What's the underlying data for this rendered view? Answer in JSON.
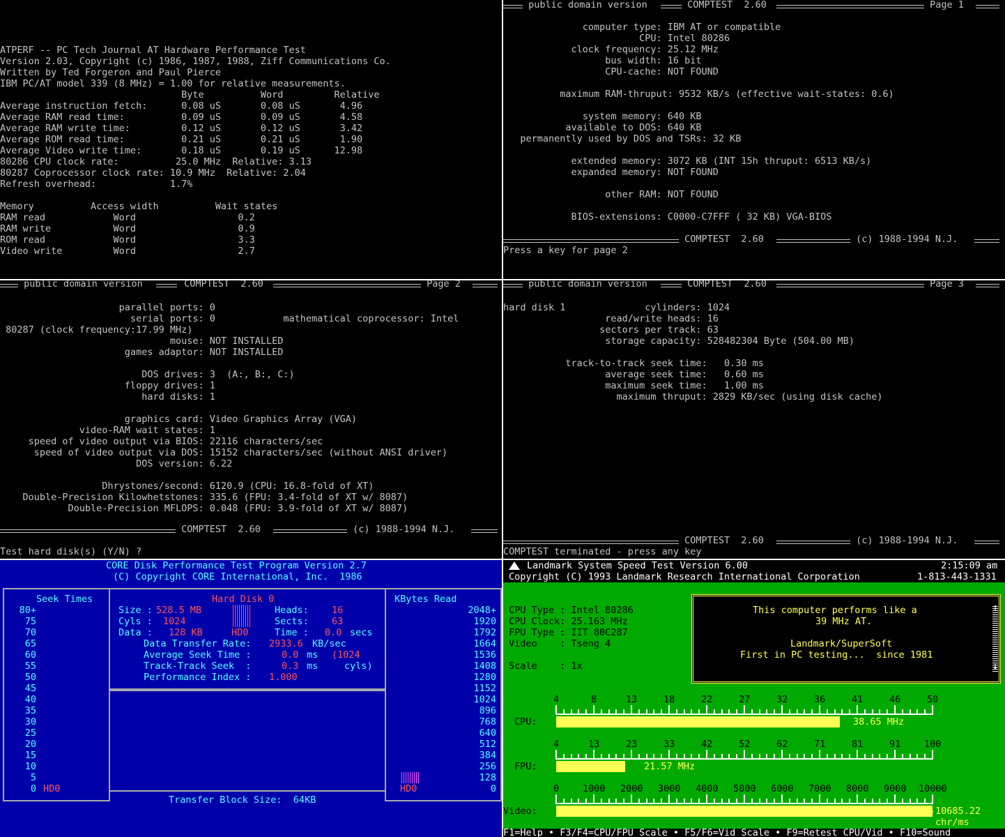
{
  "atperf": {
    "lines": [
      "",
      "",
      "",
      "",
      "ATPERF -- PC Tech Journal AT Hardware Performance Test",
      "Version 2.03, Copyright (c) 1986, 1987, 1988, Ziff Communications Co.",
      "Written by Ted Forgeron and Paul Pierce",
      "IBM PC/AT model 339 (8 MHz) = 1.00 for relative measurements.",
      "                                Byte          Word         Relative",
      "Average instruction fetch:      0.08 uS       0.08 uS       4.96",
      "Average RAM read time:          0.09 uS       0.09 uS       4.58",
      "Average RAM write time:         0.12 uS       0.12 uS       3.42",
      "Average ROM read time:          0.21 uS       0.21 uS       1.90",
      "Average Video write time:       0.18 uS       0.19 uS      12.98",
      "80286 CPU clock rate:          25.0 MHz  Relative: 3.13",
      "80287 Coprocessor clock rate: 10.9 MHz  Relative: 2.04",
      "Refresh overhead:             1.7%",
      "",
      "Memory          Access width          Wait states",
      "RAM read            Word                  0.2",
      "RAM write           Word                  0.9",
      "ROM read            Word                  3.3",
      "Video write         Word                  2.7"
    ]
  },
  "comptest_p1": {
    "header_left": " public domain version ",
    "header_mid": " COMPTEST  2.60 ",
    "header_right": " Page 1 ",
    "lines": [
      "              computer type: IBM AT or compatible",
      "                        CPU: Intel 80286",
      "            clock frequency: 25.12 MHz",
      "                  bus width: 16 bit",
      "                  CPU-cache: NOT FOUND",
      "",
      "          maximum RAM-thruput: 9532 KB/s (effective wait-states: 0.6)",
      "",
      "              system memory: 640 KB",
      "           available to DOS: 640 KB",
      "   permanently used by DOS and TSRs: 32 KB",
      "",
      "            extended memory: 3072 KB (INT 15h thruput: 6513 KB/s)",
      "            expanded memory: NOT FOUND",
      "",
      "                  other RAM: NOT FOUND",
      "",
      "            BIOS-extensions: C0000-C7FFF ( 32 KB) VGA-BIOS"
    ],
    "footer_mid": " COMPTEST  2.60 ",
    "footer_right": " (c) 1988-1994 N.J. ",
    "prompt": "Press a key for page 2"
  },
  "comptest_p2": {
    "header_left": " public domain version ",
    "header_mid": " COMPTEST  2.60 ",
    "header_right": " Page 2 ",
    "lines": [
      "                     parallel ports: 0",
      "                       serial ports: 0            mathematical coprocessor: Intel",
      " 80287 (clock frequency:17.99 MHz)",
      "                              mouse: NOT INSTALLED",
      "                      games adaptor: NOT INSTALLED",
      "",
      "                         DOS drives: 3  (A:, B:, C:)",
      "                      floppy drives: 1",
      "                         hard disks: 1",
      "",
      "                      graphics card: Video Graphics Array (VGA)",
      "              video-RAM wait states: 1",
      "     speed of video output via BIOS: 22116 characters/sec",
      "      speed of video output via DOS: 15152 characters/sec (without ANSI driver)",
      "                        DOS version: 6.22",
      "",
      "                  Dhrystones/second: 6120.9 (CPU: 16.8-fold of XT)",
      "    Double-Precision Kilowhetstones: 335.6 (FPU: 3.4-fold of XT w/ 8087)",
      "            Double-Precision MFLOPS: 0.048 (FPU: 3.9-fold of XT w/ 8087)"
    ],
    "footer_mid": " COMPTEST  2.60 ",
    "footer_right": " (c) 1988-1994 N.J. ",
    "prompt": "Test hard disk(s) (Y/N) ?"
  },
  "comptest_p3": {
    "header_left": " public domain version ",
    "header_mid": " COMPTEST  2.60 ",
    "header_right": " Page 3 ",
    "lines": [
      "hard disk 1              cylinders: 1024",
      "                  read/write heads: 16",
      "                 sectors per track: 63",
      "                  storage capacity: 528482304 Byte (504.00 MB)",
      "",
      "           track-to-track seek time:   0.30 ms",
      "                  average seek time:   0.60 ms",
      "                  maximum seek time:   1.00 ms",
      "                    maximum thruput: 2829 KB/sec (using disk cache)"
    ],
    "footer_mid": " COMPTEST  2.60 ",
    "footer_right": " (c) 1988-1994 N.J. ",
    "prompt": "COMPTEST terminated - press any key"
  },
  "core": {
    "title1": "CORE Disk Performance Test Program Version 2.7",
    "title2": "(C) Copyright CORE International, Inc.  1986",
    "seek_title": "Seek Times",
    "seek_ticks": [
      "80+",
      "75",
      "70",
      "65",
      "60",
      "55",
      "50",
      "45",
      "40",
      "35",
      "30",
      "25",
      "20",
      "15",
      "10",
      "5",
      "0"
    ],
    "seek_drive": "HD0",
    "hd_title": "Hard Disk 0",
    "size_label": "Size :",
    "size_value": "528.5 MB",
    "heads_label": "Heads:",
    "heads_value": "16",
    "cyls_label": "Cyls :",
    "cyls_value": "1024",
    "sects_label": "Sects:",
    "sects_value": "63",
    "data_label": "Data :",
    "data_value": "128 KB",
    "data_drive": "HD0",
    "time_label": "Time :",
    "time_value": "0.0",
    "time_unit": "secs",
    "dtr_label": "Data Transfer Rate:",
    "dtr_value": "2933.6",
    "dtr_unit": "KB/sec",
    "ast_label": "Average Seek Time :",
    "ast_value": "0.0",
    "ast_unit": "ms",
    "ast_extra": "(1024",
    "tts_label": "Track-Track Seek  :",
    "tts_value": "0.3",
    "tts_unit": "ms",
    "tts_extra": "cyls)",
    "pi_label": "Performance Index :",
    "pi_value": "1.000",
    "kb_title": "KBytes Read",
    "kb_ticks": [
      "2048+",
      "1920",
      "1792",
      "1664",
      "1536",
      "1408",
      "1280",
      "1152",
      "1024",
      "896",
      "768",
      "640",
      "512",
      "384",
      "256",
      "128",
      "0"
    ],
    "kb_drive": "HD0",
    "block_size": "Transfer Block Size:  64KB"
  },
  "landmark": {
    "title": "Landmark System Speed Test Version 6.00",
    "time": "2:15:09 am",
    "copyright": "Copyright (C) 1993 Landmark Research International Corporation",
    "phone": "1-813-443-1331",
    "cpu_type": "CPU Type : Intel 80286",
    "cpu_clock": "CPU Clock: 25.163 MHz",
    "fpu_type": "FPU Type : IIT 80C287",
    "video": "Video    : Tseng 4",
    "scale": "Scale    : 1x",
    "box1": "This computer performs like a",
    "box2": "39 MHz AT.",
    "box3": "Landmark/SuperSoft",
    "box4": "First in PC testing...  since 1981",
    "cpu_label": "CPU:",
    "cpu_ticks": [
      "4",
      "8",
      "13",
      "18",
      "22",
      "27",
      "32",
      "36",
      "41",
      "46",
      "50"
    ],
    "cpu_value": 38.65,
    "cpu_value_text": "38.65 MHz",
    "fpu_label": "FPU:",
    "fpu_ticks": [
      "4",
      "13",
      "23",
      "33",
      "42",
      "52",
      "62",
      "71",
      "81",
      "91",
      "100"
    ],
    "fpu_value": 21.57,
    "fpu_value_text": "21.57 MHz",
    "video_label": "Video:",
    "video_ticks": [
      "0",
      "1000",
      "2000",
      "3000",
      "4000",
      "5000",
      "6000",
      "7000",
      "8000",
      "9000",
      "10000"
    ],
    "video_value": 10685.22,
    "video_value_text": "10685.22",
    "video_unit": "chr/ms",
    "footer": "F1=Help • F3/F4=CPU/FPU Scale • F5/F6=Vid Scale • F9=Retest CPU/Vid • F10=Sound"
  }
}
